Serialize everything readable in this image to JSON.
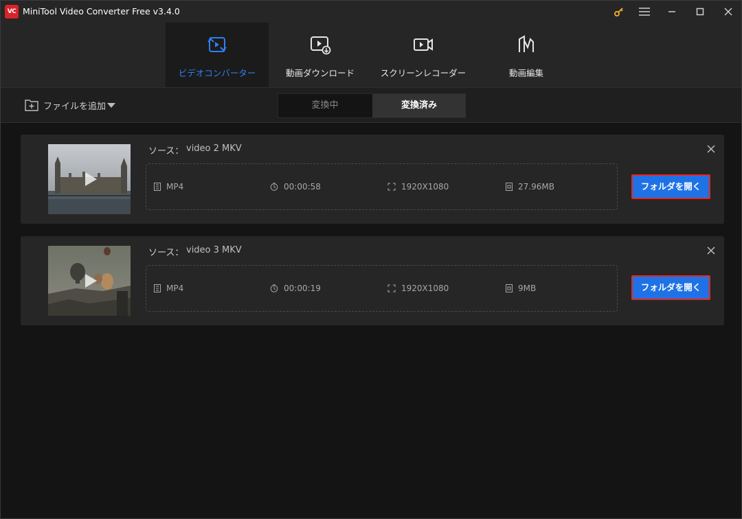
{
  "app": {
    "title": "MiniTool Video Converter Free v3.4.0",
    "logo_text": "VC"
  },
  "nav": {
    "tabs": [
      {
        "label": "ビデオコンバーター",
        "icon": "convert-icon",
        "active": true
      },
      {
        "label": "動画ダウンロード",
        "icon": "video-download-icon",
        "active": false
      },
      {
        "label": "スクリーンレコーダー",
        "icon": "screen-record-icon",
        "active": false
      },
      {
        "label": "動画編集",
        "icon": "video-edit-icon",
        "active": false
      }
    ]
  },
  "toolbar": {
    "add_file_label": "ファイルを追加",
    "segments": {
      "converting": "変換中",
      "converted": "変換済み"
    }
  },
  "items": [
    {
      "source_label": "ソース：",
      "source_name": "video 2 MKV",
      "format": "MP4",
      "duration": "00:00:58",
      "resolution": "1920X1080",
      "size": "27.96MB",
      "open_button": "フォルダを開く"
    },
    {
      "source_label": "ソース：",
      "source_name": "video 3 MKV",
      "format": "MP4",
      "duration": "00:00:19",
      "resolution": "1920X1080",
      "size": "9MB",
      "open_button": "フォルダを開く"
    }
  ],
  "colors": {
    "accent": "#2f7ff2",
    "button": "#1f72e6",
    "highlight_border": "#e8261c",
    "brand_red": "#d8232a",
    "key_icon": "#e7a82b"
  }
}
